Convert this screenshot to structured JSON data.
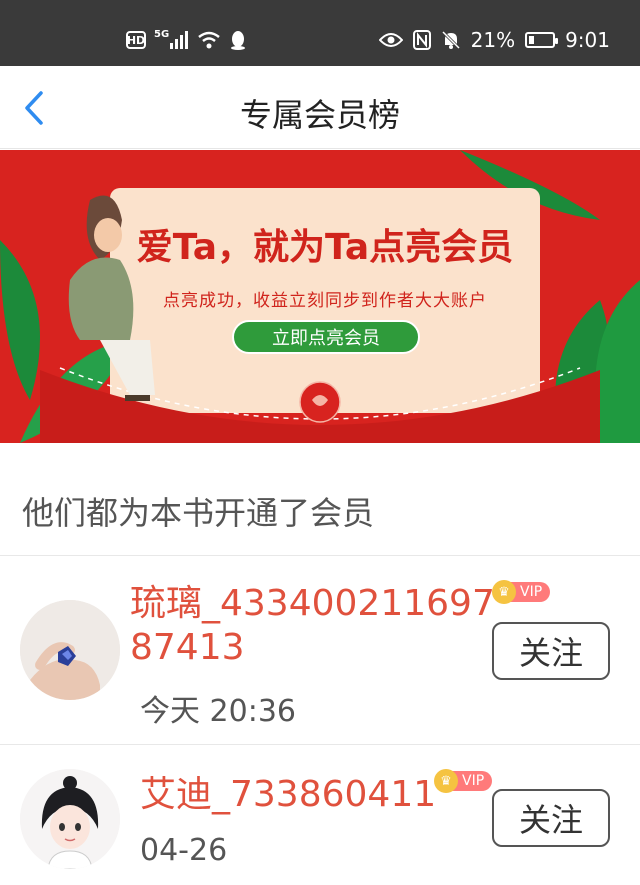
{
  "status_bar": {
    "hd": "HD",
    "network": "5G",
    "battery_text": "21%",
    "battery_level": 0.21,
    "time": "9:01",
    "nfc": "N"
  },
  "nav": {
    "title": "专属会员榜",
    "back_icon": "chevron-left-icon",
    "accent": "#2f8cf0"
  },
  "banner": {
    "headline": "爱Ta，就为Ta点亮会员",
    "subtitle": "点亮成功，收益立刻同步到作者大大账户",
    "button_label": "立即点亮会员",
    "bg_color": "#d8231f",
    "card_color": "#fbe2cc"
  },
  "section": {
    "heading": "他们都为本书开通了会员"
  },
  "members": [
    {
      "name": "琉璃_43340021169787413",
      "badge": "VIP",
      "time": "今天 20:36",
      "follow_label": "关注",
      "avatar": "hand-holding-crystal-avatar"
    },
    {
      "name": "艾迪_733860411",
      "badge": "VIP",
      "time": "04-26",
      "follow_label": "关注",
      "avatar": "anime-girl-avatar"
    }
  ]
}
